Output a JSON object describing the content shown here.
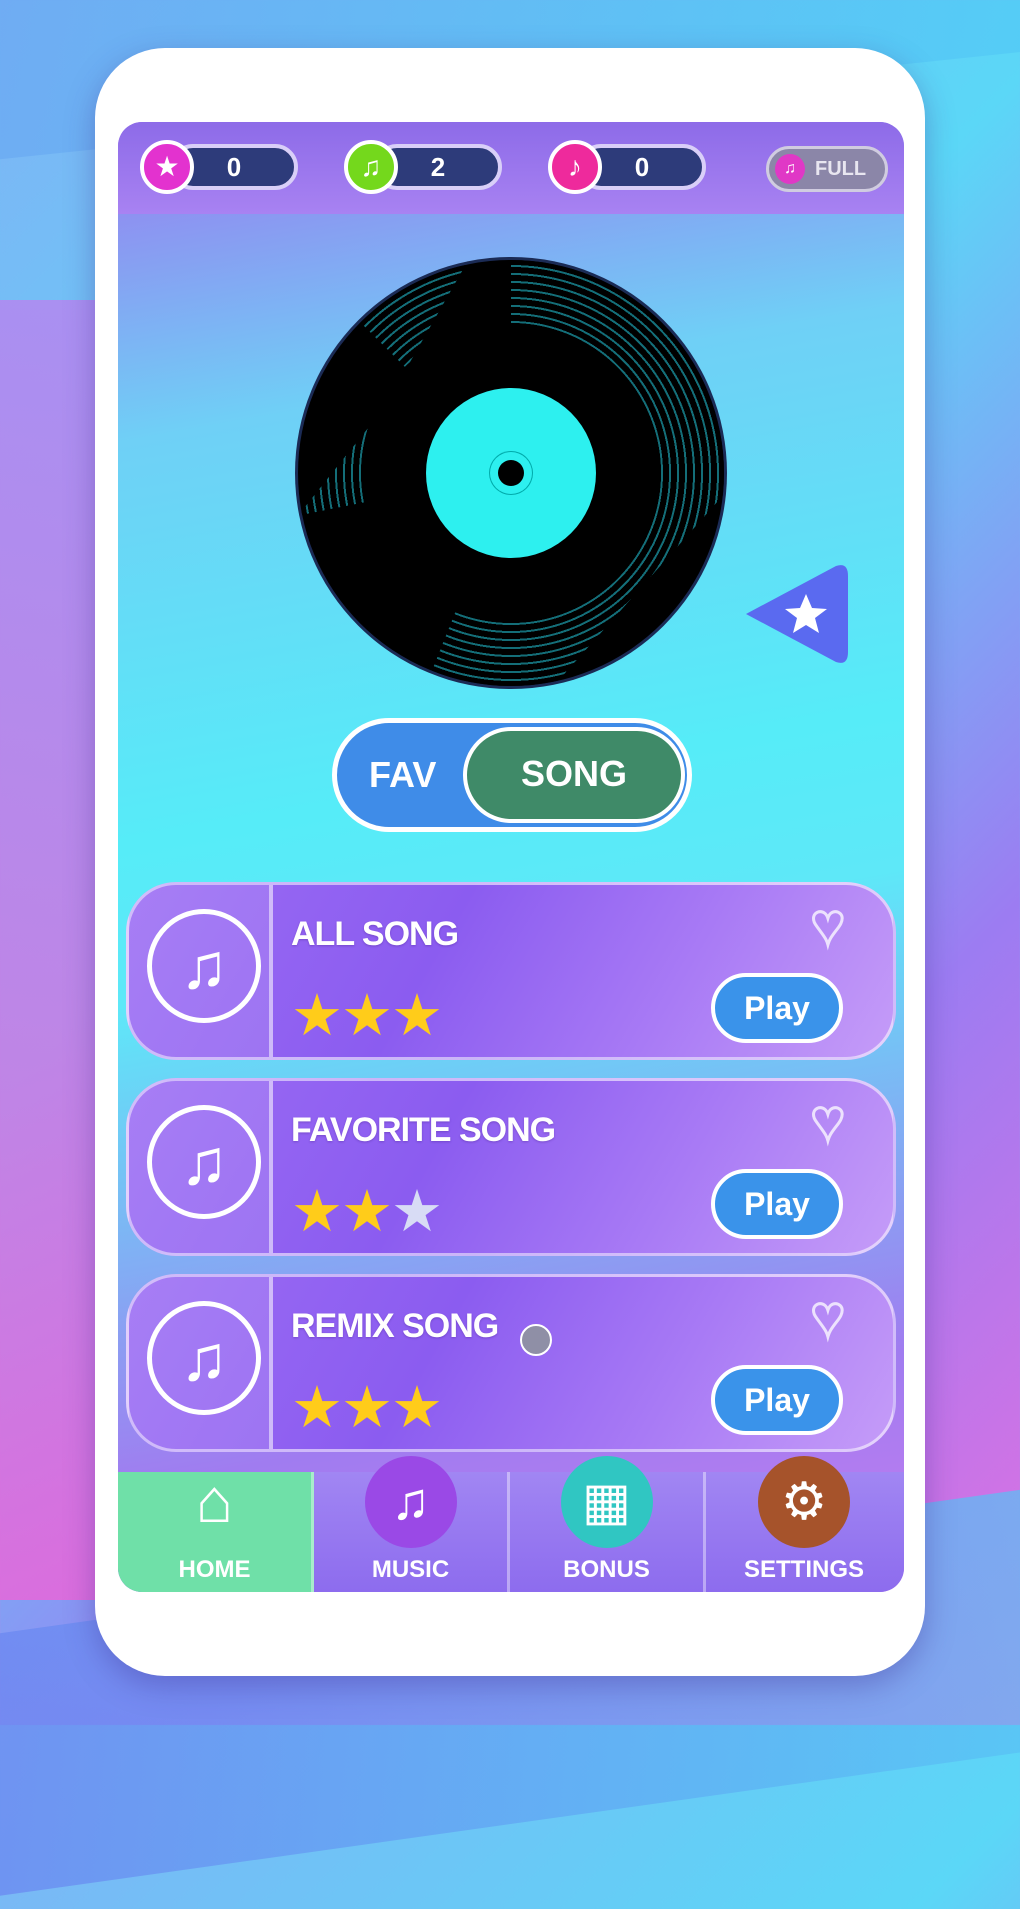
{
  "counters": [
    {
      "icon": "star-icon",
      "value": "0",
      "color": "#e332cf"
    },
    {
      "icon": "music-note-icon",
      "value": "2",
      "color": "#74d81c"
    },
    {
      "icon": "music-note-icon",
      "value": "0",
      "color": "#ee2a9c"
    }
  ],
  "full_label": "FULL",
  "toggle": {
    "fav_label": "FAV",
    "song_label": "SONG"
  },
  "songs": [
    {
      "title": "ALL SONG",
      "stars": 3,
      "play_label": "Play"
    },
    {
      "title": "FAVORITE SONG",
      "stars": 2,
      "play_label": "Play"
    },
    {
      "title": "REMIX SONG",
      "stars": 3,
      "play_label": "Play"
    }
  ],
  "tabs": [
    {
      "label": "HOME",
      "icon": "home-icon"
    },
    {
      "label": "MUSIC",
      "icon": "music-note-icon"
    },
    {
      "label": "BONUS",
      "icon": "gift-icon"
    },
    {
      "label": "SETTINGS",
      "icon": "gear-icon"
    }
  ],
  "colors": {
    "accent": "#8d6be8",
    "play": "#3a93ea",
    "song_toggle": "#3f8a68",
    "home_tab": "#6fe0a8",
    "star": "#ffcc1a"
  }
}
